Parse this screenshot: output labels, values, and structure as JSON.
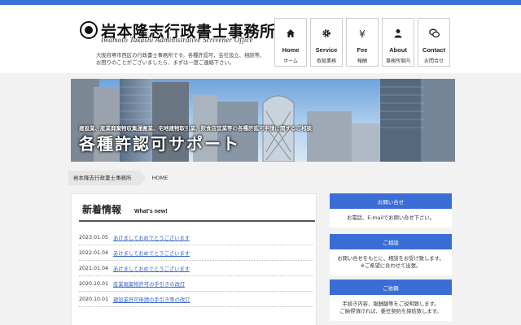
{
  "header": {
    "logo_title": "岩本隆志行政書士事務所",
    "logo_en": "Iwamoto Takashi Administrative Scrivener Office",
    "intro": "大阪府堺市西区の行政書士事務所です。各種許認可、会社設立、相続等、お困りのことがございましたら、まずは一度ご連絡下さい。"
  },
  "nav": [
    {
      "icon": "home-icon",
      "en": "Home",
      "ja": "ホーム"
    },
    {
      "icon": "gear-icon",
      "en": "Service",
      "ja": "取扱業務"
    },
    {
      "icon": "yen-icon",
      "en": "Fee",
      "ja": "報酬"
    },
    {
      "icon": "user-icon",
      "en": "About",
      "ja": "事務所案内"
    },
    {
      "icon": "chat-icon",
      "en": "Contact",
      "ja": "お問合せ"
    }
  ],
  "hero": {
    "subtitle": "建設業、産業廃棄物収集運搬業、宅地建物取引業、飲食店営業等の各種許認可申請に関するご相談",
    "title": "各種許認可サポート"
  },
  "breadcrumb": {
    "home": "岩本隆志行政書士事務所",
    "current": "HOME"
  },
  "news": {
    "title": "新着情報",
    "subtitle": "What's new!",
    "items": [
      {
        "date": "2023.01.05",
        "text": "あけましておめでとうございます"
      },
      {
        "date": "2022.01.04",
        "text": "あけましておめでとうございます"
      },
      {
        "date": "2021.01.04",
        "text": "あけましておめでとうございます"
      },
      {
        "date": "2020.10.01",
        "text": "産業廃棄物許可の手引きの改訂"
      },
      {
        "date": "2020.10.01",
        "text": "建設業許可申請の手引き等の改訂"
      }
    ]
  },
  "sidebar": [
    {
      "heading": "お問い合せ",
      "lines": [
        "お電話、E-mailでお問い合せ下さい。"
      ]
    },
    {
      "heading": "ご相談",
      "lines": [
        "お問い合せをもとに、相談をお受け致します。",
        "※ご希望に合わせて出張。"
      ]
    },
    {
      "heading": "ご依頼",
      "lines": [
        "手続き内容、報酬額等をご説明致します。",
        "ご納得頂ければ、委任契約を締結致します。"
      ]
    }
  ],
  "colors": {
    "accent": "#3a6ed6",
    "link": "#3a66c4"
  }
}
